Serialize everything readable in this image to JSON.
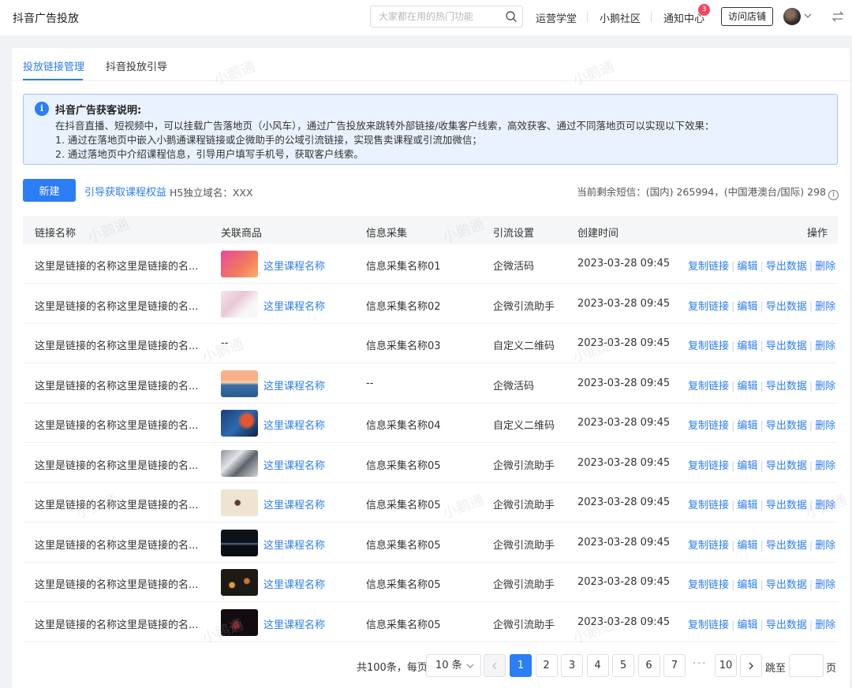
{
  "header": {
    "title": "抖音广告投放",
    "search_placeholder": "大家都在用的热门功能",
    "nav": [
      "运营学堂",
      "小鹅社区",
      "通知中心"
    ],
    "notification_count": "3",
    "visit_store": "访问店铺"
  },
  "tabs": [
    "投放链接管理",
    "抖音投放引导"
  ],
  "notice": {
    "title": "抖音广告获客说明:",
    "lines": [
      "在抖音直播、短视频中，可以挂载广告落地页（小风车），通过广告投放来跳转外部链接/收集客户线索，高效获客、通过不同落地页可以实现以下效果：",
      "1. 通过在落地页中嵌入小鹅通课程链接或企微助手的公域引流链接，实现售卖课程或引流加微信；",
      "2. 通过落地页中介绍课程信息，引导用户填写手机号，获取客户线索。"
    ]
  },
  "toolbar": {
    "new_button": "新建",
    "guide_link": "引导获取课程权益",
    "domain_label": "H5独立域名：XXX",
    "sms_info": "当前剩余短信：(国内) 265994，(中国港澳台/国际) 298"
  },
  "table": {
    "columns": [
      "链接名称",
      "关联商品",
      "信息采集",
      "引流设置",
      "创建时间",
      "操作"
    ],
    "actions": [
      "复制链接",
      "编辑",
      "导出数据",
      "删除"
    ],
    "rows": [
      {
        "name": "这里是链接的名称这里是链接的名...",
        "product": "这里课程名称",
        "collect": "信息采集名称01",
        "traffic": "企微活码",
        "time": "2023-03-28 09:45",
        "thumb": "thumb-1"
      },
      {
        "name": "这里是链接的名称这里是链接的名...",
        "product": "这里课程名称",
        "collect": "信息采集名称02",
        "traffic": "企微引流助手",
        "time": "2023-03-28 09:45",
        "thumb": "thumb-2"
      },
      {
        "name": "这里是链接的名称这里是链接的名...",
        "product": "--",
        "collect": "信息采集名称03",
        "traffic": "自定义二维码",
        "time": "2023-03-28 09:45",
        "thumb": ""
      },
      {
        "name": "这里是链接的名称这里是链接的名...",
        "product": "这里课程名称",
        "collect": "--",
        "traffic": "企微活码",
        "time": "2023-03-28 09:45",
        "thumb": "thumb-4"
      },
      {
        "name": "这里是链接的名称这里是链接的名...",
        "product": "这里课程名称",
        "collect": "信息采集名称04",
        "traffic": "自定义二维码",
        "time": "2023-03-28 09:45",
        "thumb": "thumb-5"
      },
      {
        "name": "这里是链接的名称这里是链接的名...",
        "product": "这里课程名称",
        "collect": "信息采集名称05",
        "traffic": "企微引流助手",
        "time": "2023-03-28 09:45",
        "thumb": "thumb-6"
      },
      {
        "name": "这里是链接的名称这里是链接的名...",
        "product": "这里课程名称",
        "collect": "信息采集名称05",
        "traffic": "企微引流助手",
        "time": "2023-03-28 09:45",
        "thumb": "thumb-7"
      },
      {
        "name": "这里是链接的名称这里是链接的名...",
        "product": "这里课程名称",
        "collect": "信息采集名称05",
        "traffic": "企微引流助手",
        "time": "2023-03-28 09:45",
        "thumb": "thumb-8"
      },
      {
        "name": "这里是链接的名称这里是链接的名...",
        "product": "这里课程名称",
        "collect": "信息采集名称05",
        "traffic": "企微引流助手",
        "time": "2023-03-28 09:45",
        "thumb": "thumb-9"
      },
      {
        "name": "这里是链接的名称这里是链接的名...",
        "product": "这里课程名称",
        "collect": "信息采集名称05",
        "traffic": "企微引流助手",
        "time": "2023-03-28 09:45",
        "thumb": "thumb-10"
      }
    ]
  },
  "pagination": {
    "total": "共100条，每页",
    "page_size": "10 条",
    "pages": [
      "1",
      "2",
      "3",
      "4",
      "5",
      "6",
      "7"
    ],
    "ellipsis": "···",
    "last_page": "10",
    "current": "1",
    "jump_label": "跳至",
    "suffix": "页"
  },
  "watermark": "小鹅通",
  "colors": {
    "accent": "#2b7ef5",
    "badge": "#f5455c"
  }
}
